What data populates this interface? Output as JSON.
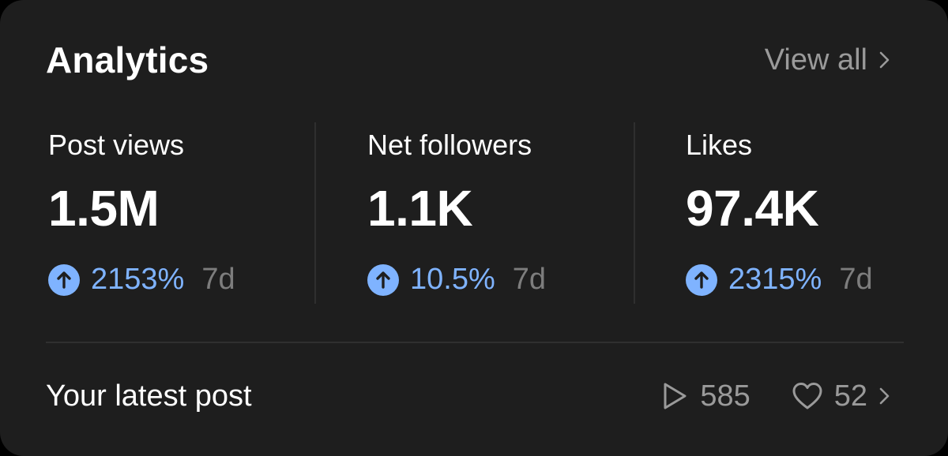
{
  "header": {
    "title": "Analytics",
    "view_all_label": "View all"
  },
  "stats": [
    {
      "label": "Post views",
      "value": "1.5M",
      "change": "2153%",
      "period": "7d"
    },
    {
      "label": "Net followers",
      "value": "1.1K",
      "change": "10.5%",
      "period": "7d"
    },
    {
      "label": "Likes",
      "value": "97.4K",
      "change": "2315%",
      "period": "7d"
    }
  ],
  "latest_post": {
    "label": "Your latest post",
    "plays": "585",
    "likes": "52"
  },
  "icons": {
    "view_all": "chevron-right-icon",
    "change": "arrow-up-circle-icon",
    "plays": "play-icon",
    "likes": "heart-icon",
    "latest_post": "chevron-right-icon"
  },
  "colors": {
    "card_background": "#1e1e1e",
    "accent_positive": "#7fb3ff",
    "arrow_circle": "#7fb3ff",
    "muted_text": "#9a9a9a",
    "period_text": "#7d7d7d",
    "divider": "#2f2f2f"
  }
}
